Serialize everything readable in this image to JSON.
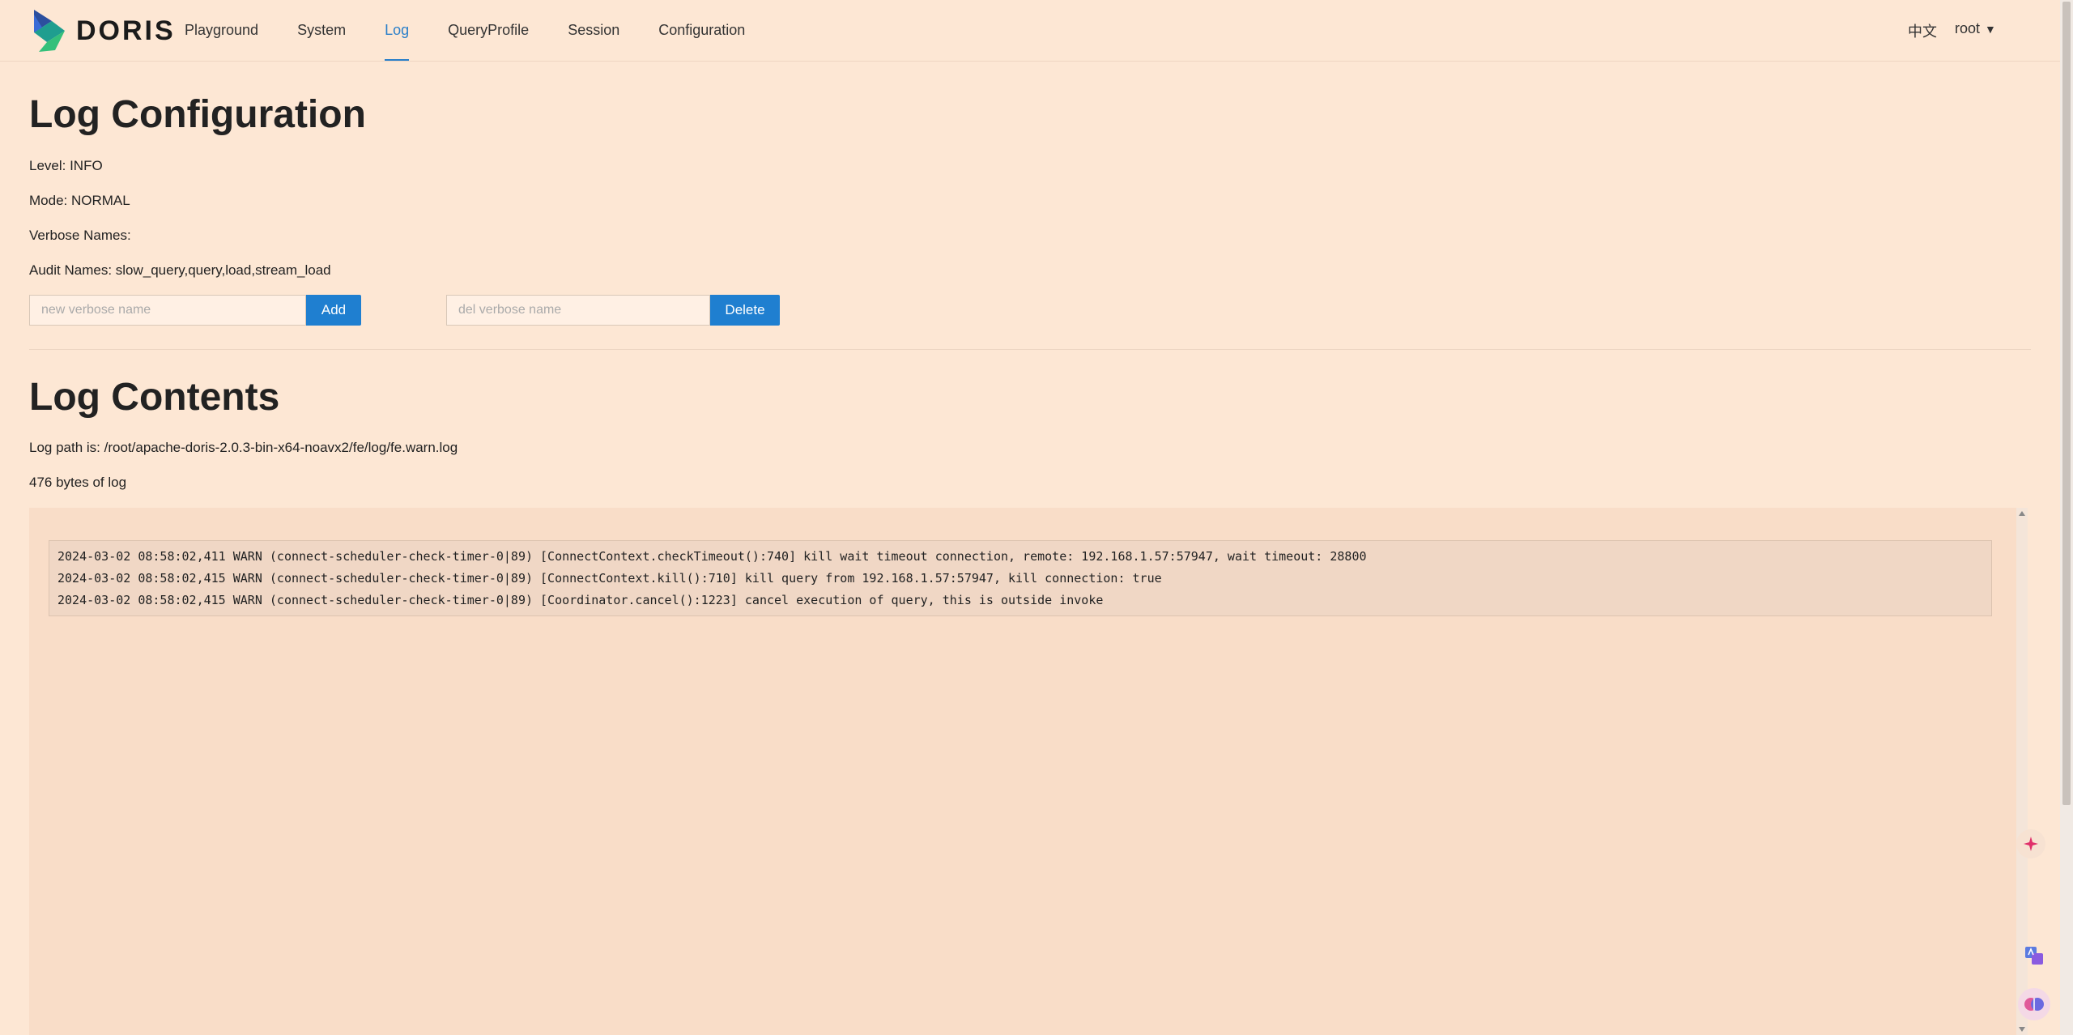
{
  "brand": {
    "name": "DORIS"
  },
  "nav": {
    "items": [
      {
        "label": "Playground"
      },
      {
        "label": "System"
      },
      {
        "label": "Log",
        "active": true
      },
      {
        "label": "QueryProfile"
      },
      {
        "label": "Session"
      },
      {
        "label": "Configuration"
      }
    ],
    "language": "中文",
    "user": "root"
  },
  "log_config": {
    "title": "Log Configuration",
    "level": "Level: INFO",
    "mode": "Mode: NORMAL",
    "verbose_names": "Verbose Names:",
    "audit_names": "Audit Names: slow_query,query,load,stream_load",
    "add_input_placeholder": "new verbose name",
    "add_button": "Add",
    "del_input_placeholder": "del verbose name",
    "delete_button": "Delete"
  },
  "log_contents": {
    "title": "Log Contents",
    "path": "Log path is: /root/apache-doris-2.0.3-bin-x64-noavx2/fe/log/fe.warn.log",
    "size": "476 bytes of log",
    "lines": [
      "2024-03-02 08:58:02,411 WARN (connect-scheduler-check-timer-0|89) [ConnectContext.checkTimeout():740] kill wait timeout connection, remote: 192.168.1.57:57947, wait timeout: 28800",
      "2024-03-02 08:58:02,415 WARN (connect-scheduler-check-timer-0|89) [ConnectContext.kill():710] kill query from 192.168.1.57:57947, kill connection: true",
      "2024-03-02 08:58:02,415 WARN (connect-scheduler-check-timer-0|89) [Coordinator.cancel():1223] cancel execution of query, this is outside invoke"
    ]
  },
  "colors": {
    "background": "#fde7d4",
    "accent": "#2a7fc9",
    "button": "#1f7fd0",
    "log_panel": "#f9ddc8"
  }
}
